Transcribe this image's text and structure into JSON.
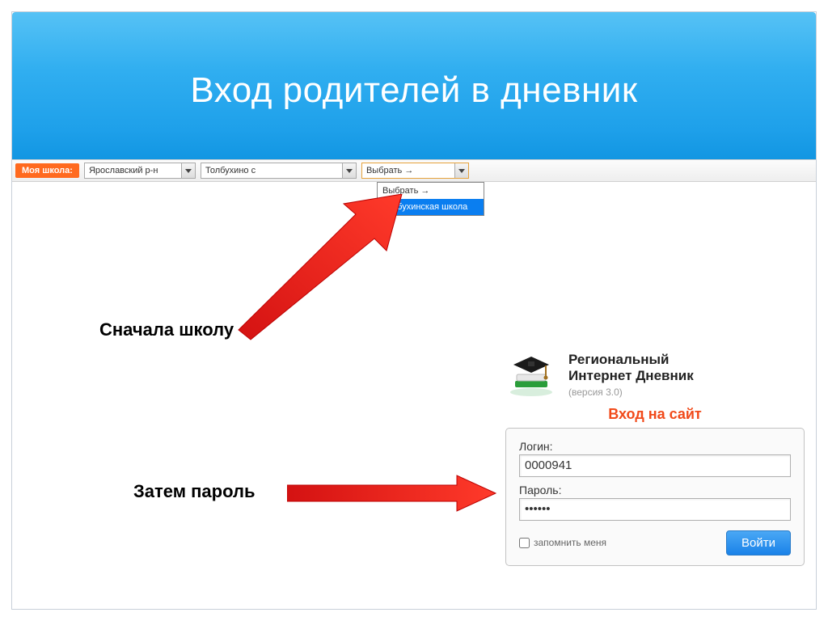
{
  "slide": {
    "title": "Вход родителей в дневник"
  },
  "selector": {
    "label": "Моя школа:",
    "region": "Ярославский р-н",
    "locality": "Толбухино с",
    "school_placeholder": "Выбрать →",
    "dropdown": {
      "opt1": "Выбрать →",
      "opt2": "Толбухинская школа"
    }
  },
  "captions": {
    "first": "Сначала школу",
    "second": "Затем пароль"
  },
  "brand": {
    "line1": "Региональный",
    "line2": "Интернет Дневник",
    "version": "(версия 3.0)"
  },
  "login": {
    "heading": "Вход на сайт",
    "login_label": "Логин:",
    "login_value": "0000941",
    "password_label": "Пароль:",
    "password_value": "••••••",
    "remember": "запомнить меня",
    "submit": "Войти"
  }
}
